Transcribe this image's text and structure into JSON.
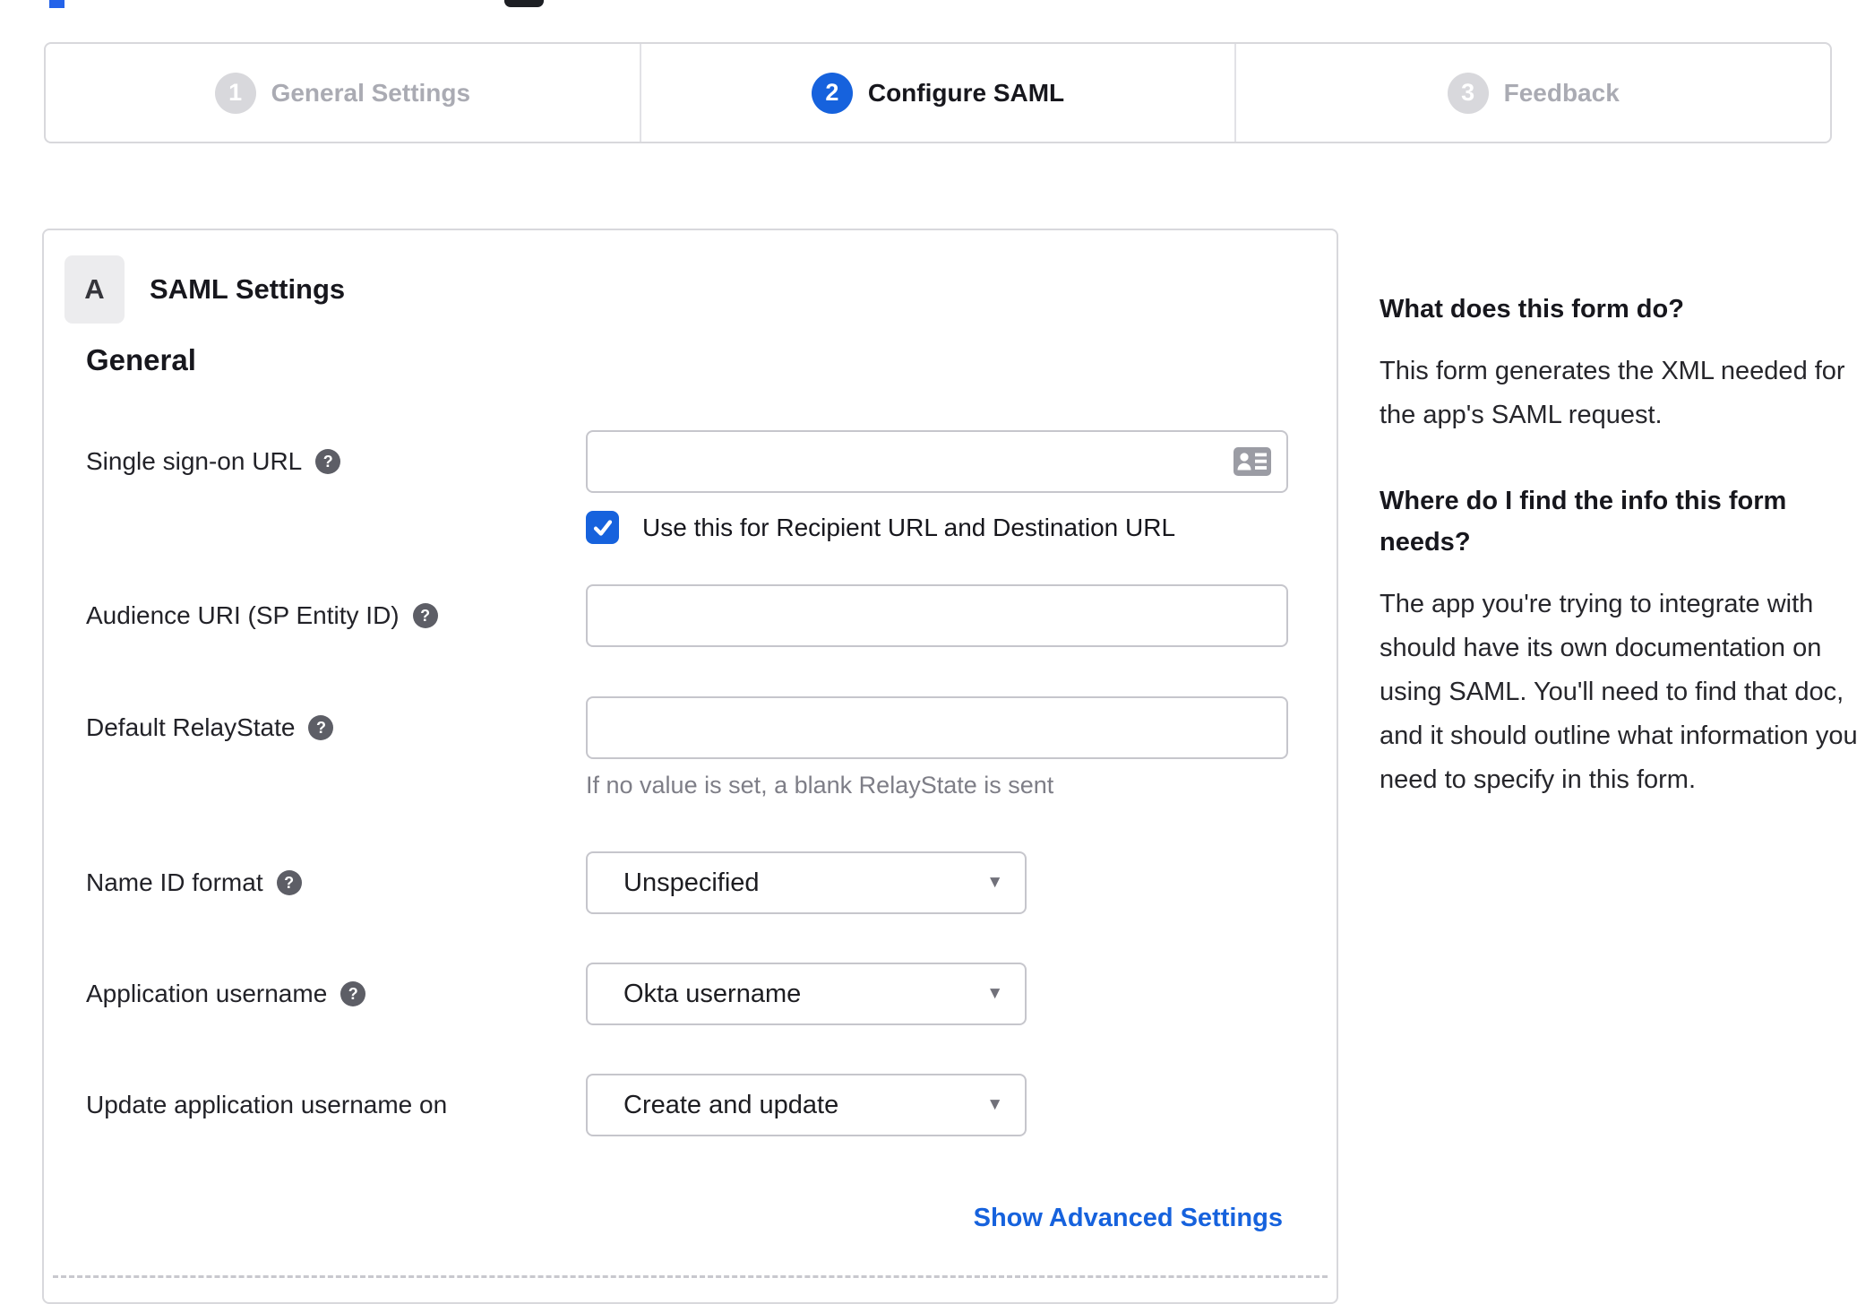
{
  "colors": {
    "accent_blue": "#1662dd",
    "inactive_gray": "#d8d8dc",
    "border_gray": "#c6c6cc",
    "panel_border": "#d8d8dc",
    "hint_gray": "#7e7e87"
  },
  "icons": {
    "help": "question-mark-circle",
    "input_icon": "contact-card",
    "checkbox_icon": "checkmark",
    "select_arrow": "▼"
  },
  "stepper": {
    "steps": [
      {
        "number": "1",
        "label": "General Settings",
        "state": "inactive"
      },
      {
        "number": "2",
        "label": "Configure SAML",
        "state": "active"
      },
      {
        "number": "3",
        "label": "Feedback",
        "state": "inactive"
      }
    ]
  },
  "panel": {
    "section_letter": "A",
    "section_title": "SAML Settings",
    "group_title": "General",
    "fields": [
      {
        "label": "Single sign-on URL",
        "type": "text",
        "value": "",
        "checkbox_checked": true,
        "checkbox_label": "Use this for Recipient URL and Destination URL"
      },
      {
        "label": "Audience URI (SP Entity ID)",
        "type": "text",
        "value": ""
      },
      {
        "label": "Default RelayState",
        "type": "text",
        "value": "",
        "hint": "If no value is set, a blank RelayState is sent"
      },
      {
        "label": "Name ID format",
        "type": "select",
        "value": "Unspecified"
      },
      {
        "label": "Application username",
        "type": "select",
        "value": "Okta username"
      },
      {
        "label": "Update application username on",
        "type": "select",
        "value": "Create and update"
      }
    ],
    "advanced_link": "Show Advanced Settings"
  },
  "sidebar": {
    "sections": [
      {
        "heading": "What does this form do?",
        "body": "This form generates the XML needed for the app's SAML request."
      },
      {
        "heading": "Where do I find the info this form needs?",
        "body": "The app you're trying to integrate with should have its own documentation on using SAML. You'll need to find that doc, and it should outline what information you need to specify in this form."
      }
    ]
  }
}
